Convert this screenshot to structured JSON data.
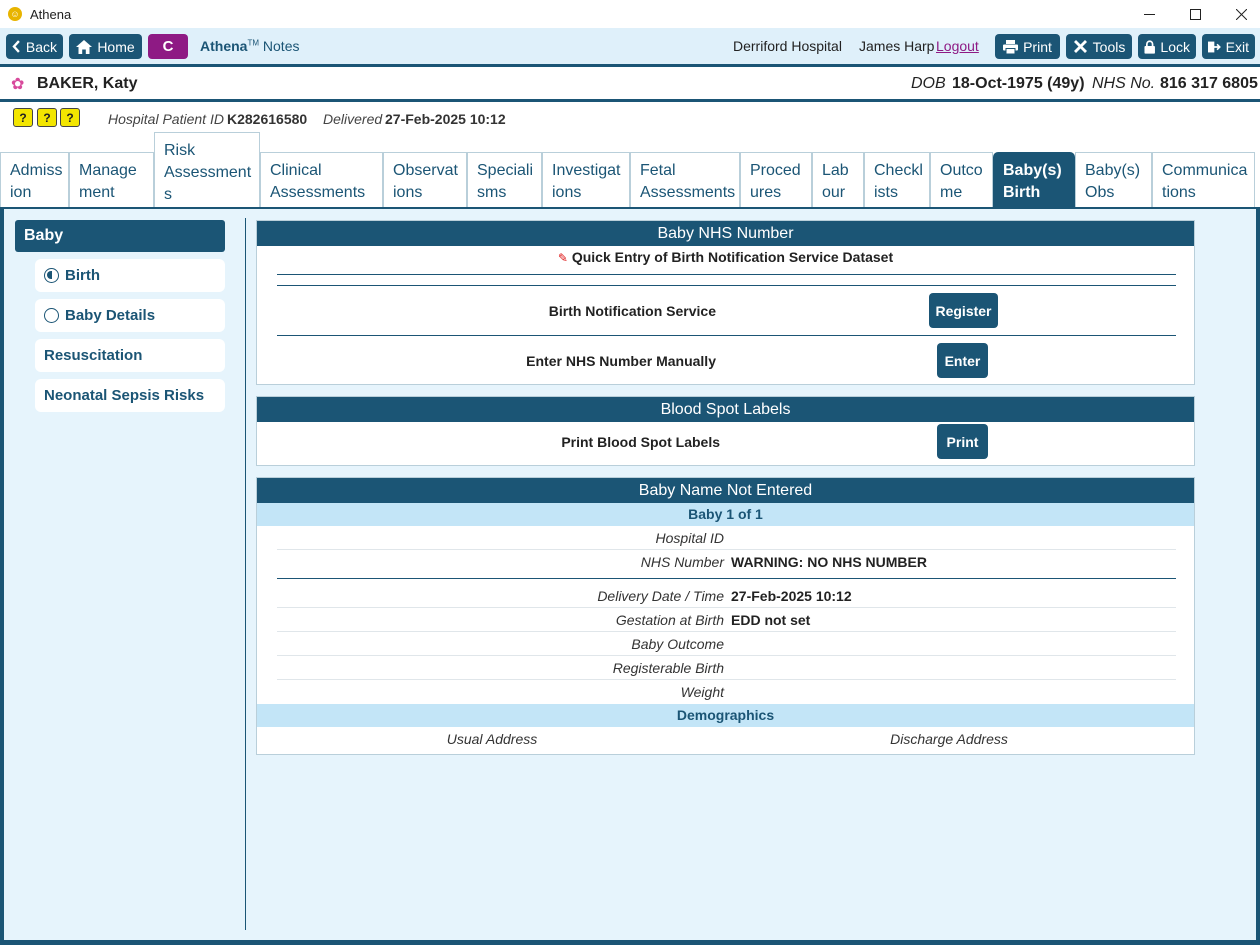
{
  "window": {
    "title": "Athena",
    "logo_glyph": "☺"
  },
  "toolbar": {
    "back": "Back",
    "home": "Home",
    "c_button": "C",
    "app_name": "Athena",
    "app_tm": "TM",
    "app_section": "Notes",
    "hospital": "Derriford Hospital",
    "user": "James Harp",
    "logout": "Logout",
    "print": "Print",
    "tools": "Tools",
    "lock": "Lock",
    "exit": "Exit"
  },
  "patient": {
    "name": "BAKER, Katy",
    "dob_label": "DOB",
    "dob_value": "18-Oct-1975 (49y)",
    "nhs_label": "NHS No.",
    "nhs_value": "816 317 6805",
    "hospital_id_label": "Hospital Patient ID",
    "hospital_id_value": "K282616580",
    "delivered_label": "Delivered",
    "delivered_value": "27-Feb-2025 10:12",
    "alert_glyphs": [
      "?",
      "?",
      "?"
    ]
  },
  "tabs": [
    {
      "line1": "Admiss",
      "line2": "ion"
    },
    {
      "line1": "Manage",
      "line2": "ment"
    },
    {
      "line1": "Risk",
      "line2": "Assessment",
      "line3": "s"
    },
    {
      "line1": "Clinical",
      "line2": "Assessments"
    },
    {
      "line1": "Observat",
      "line2": "ions"
    },
    {
      "line1": "Speciali",
      "line2": "sms"
    },
    {
      "line1": "Investigat",
      "line2": "ions"
    },
    {
      "line1": "Fetal",
      "line2": "Assessments"
    },
    {
      "line1": "Proced",
      "line2": "ures"
    },
    {
      "line1": "Lab",
      "line2": "our"
    },
    {
      "line1": "Checkl",
      "line2": "ists"
    },
    {
      "line1": "Outco",
      "line2": "me"
    },
    {
      "line1": "Baby(s)",
      "line2": "Birth"
    },
    {
      "line1": "Baby(s)",
      "line2": "Obs"
    },
    {
      "line1": "Communica",
      "line2": "tions"
    }
  ],
  "left_nav": {
    "heading": "Baby",
    "items": [
      "Birth",
      "Baby Details",
      "Resuscitation",
      "Neonatal Sepsis Risks"
    ]
  },
  "nhs_panel": {
    "title": "Baby NHS Number",
    "quick_entry": "Quick Entry of Birth Notification Service Dataset",
    "bns_label": "Birth Notification Service",
    "register_button": "Register",
    "manual_label": "Enter NHS Number Manually",
    "enter_button": "Enter"
  },
  "bloodspot_panel": {
    "title": "Blood Spot Labels",
    "print_label": "Print Blood Spot Labels",
    "print_button": "Print"
  },
  "baby_panel": {
    "title": "Baby Name Not Entered",
    "baby_counter": "Baby 1 of  1",
    "fields": [
      {
        "label": "Hospital ID",
        "value": ""
      },
      {
        "label": "NHS Number",
        "value": "WARNING: NO NHS NUMBER"
      },
      {
        "label": "Delivery Date / Time",
        "value": "27-Feb-2025 10:12"
      },
      {
        "label": "Gestation at Birth",
        "value": "EDD not set"
      },
      {
        "label": "Baby Outcome",
        "value": ""
      },
      {
        "label": "Registerable Birth",
        "value": ""
      },
      {
        "label": "Weight",
        "value": ""
      }
    ],
    "demographics_heading": "Demographics",
    "usual_address_label": "Usual Address",
    "discharge_address_label": "Discharge Address"
  },
  "colors": {
    "primary": "#1b5575",
    "accent": "#8e1a84",
    "light_bg": "#e6f4fc",
    "sub_header": "#c3e5f7",
    "alert_yellow": "#f3e600"
  }
}
